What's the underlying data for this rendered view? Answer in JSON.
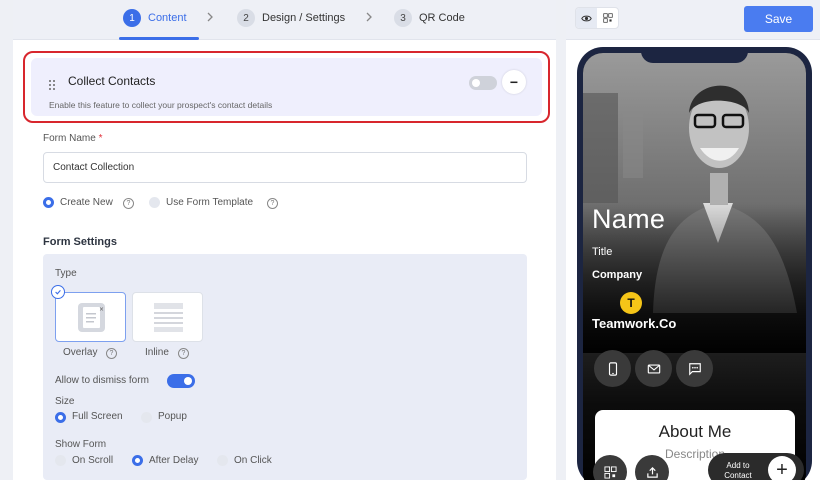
{
  "stepper": {
    "steps": [
      {
        "num": "1",
        "label": "Content"
      },
      {
        "num": "2",
        "label": "Design / Settings"
      },
      {
        "num": "3",
        "label": "QR Code"
      }
    ]
  },
  "collect": {
    "title": "Collect Contacts",
    "description": "Enable this feature to collect your prospect's contact details",
    "enabled": false,
    "remove_symbol": "−"
  },
  "form": {
    "name_label": "Form Name",
    "required_mark": "*",
    "name_value": "Contact Collection",
    "source_options": [
      "Create New",
      "Use Form Template"
    ],
    "source_selected": "Create New"
  },
  "settings": {
    "title": "Form Settings",
    "type_label": "Type",
    "type_options": [
      "Overlay",
      "Inline"
    ],
    "type_selected": "Overlay",
    "dismiss_label": "Allow to dismiss form",
    "dismiss_enabled": true,
    "size_label": "Size",
    "size_options": [
      "Full Screen",
      "Popup"
    ],
    "size_selected": "Full Screen",
    "show_label": "Show Form",
    "show_options": [
      "On Scroll",
      "After Delay",
      "On Click"
    ],
    "show_selected": "After Delay"
  },
  "toolbar": {
    "save_label": "Save"
  },
  "preview": {
    "name": "Name",
    "title": "Title",
    "company": "Company",
    "logo_letter": "T",
    "team_name": "Teamwork.Co",
    "about_title": "About Me",
    "about_desc": "Description",
    "add_contact_label": "Add to Contact",
    "add_symbol": "+"
  },
  "colors": {
    "accent": "#3b6ee8",
    "highlight_border": "#d8262d",
    "logo": "#f5c518"
  }
}
